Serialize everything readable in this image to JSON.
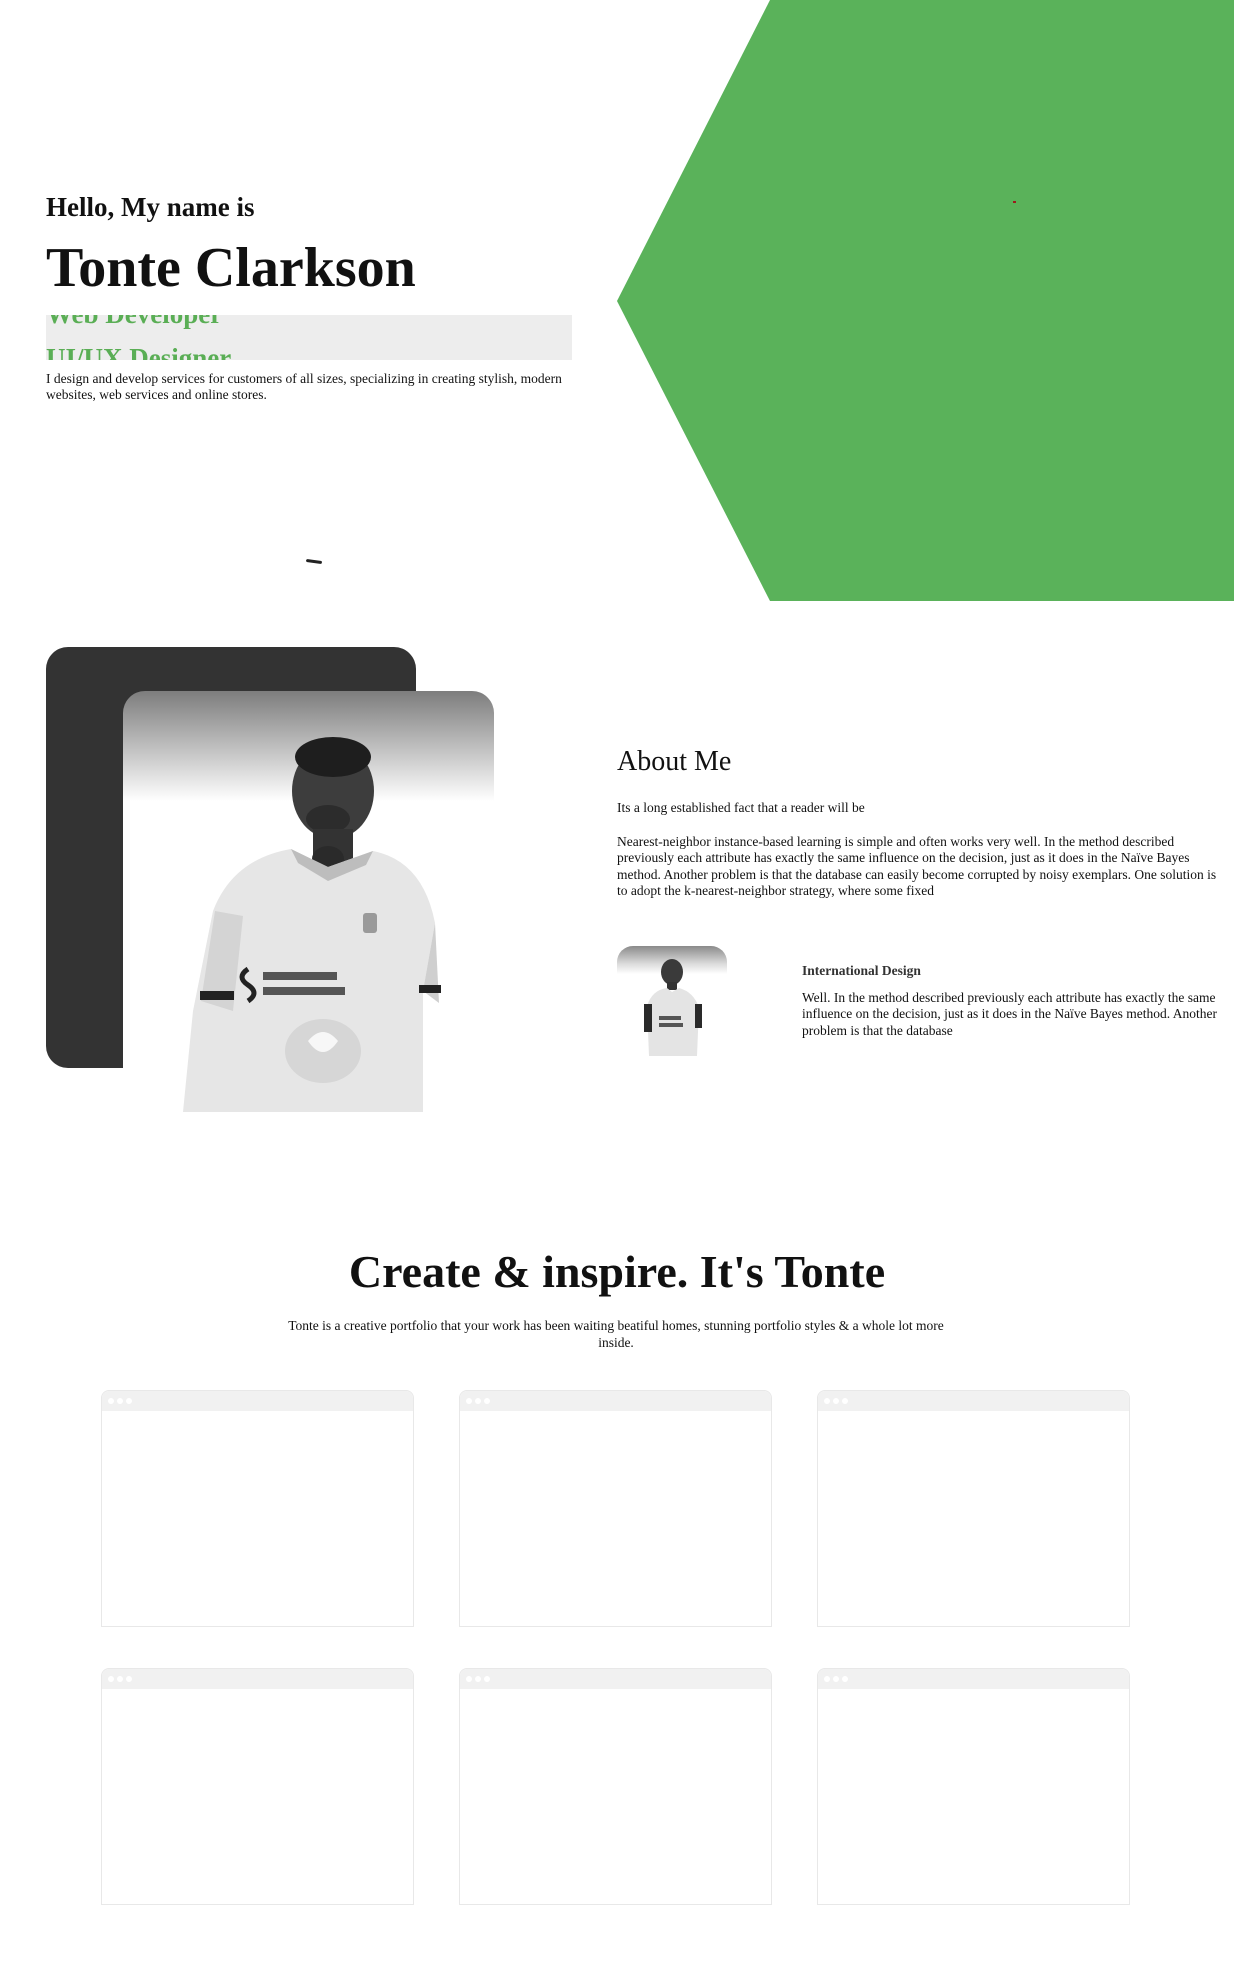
{
  "colors": {
    "accent": "#5ab25a",
    "dark_block": "#333333",
    "role_highlight": "#ededed"
  },
  "hero": {
    "greeting": "Hello, My name is",
    "name": "Tonte Clarkson",
    "roles": [
      "Web Developer",
      "UI/UX Designer"
    ],
    "intro": "I design and develop services for customers of all sizes, specializing in creating stylish, modern websites, web services and online stores."
  },
  "about": {
    "title": "About Me",
    "lead": "Its a long established fact that a reader will be",
    "body": "Nearest-neighbor instance-based learning is simple and often works very well. In the method described previously each attribute has exactly the same influence on the decision, just as it does in the Naïve Bayes method. Another problem is that the database can easily become corrupted by noisy exemplars. One solution is to adopt the k-nearest-neighbor strategy, where some fixed",
    "feature": {
      "title": "International Design",
      "body": "Well. In the method described previously each attribute has exactly the same influence on the decision, just as it does in the Naïve Bayes method. Another problem is that the database"
    },
    "photo_icon": "portrait-photo",
    "thumb_icon": "portrait-thumbnail"
  },
  "portfolio": {
    "title": "Create & inspire. It's Tonte",
    "subtitle": "Tonte is a creative portfolio that your work has been waiting beatiful homes, stunning portfolio styles & a whole lot more inside.",
    "card_count": 6
  }
}
